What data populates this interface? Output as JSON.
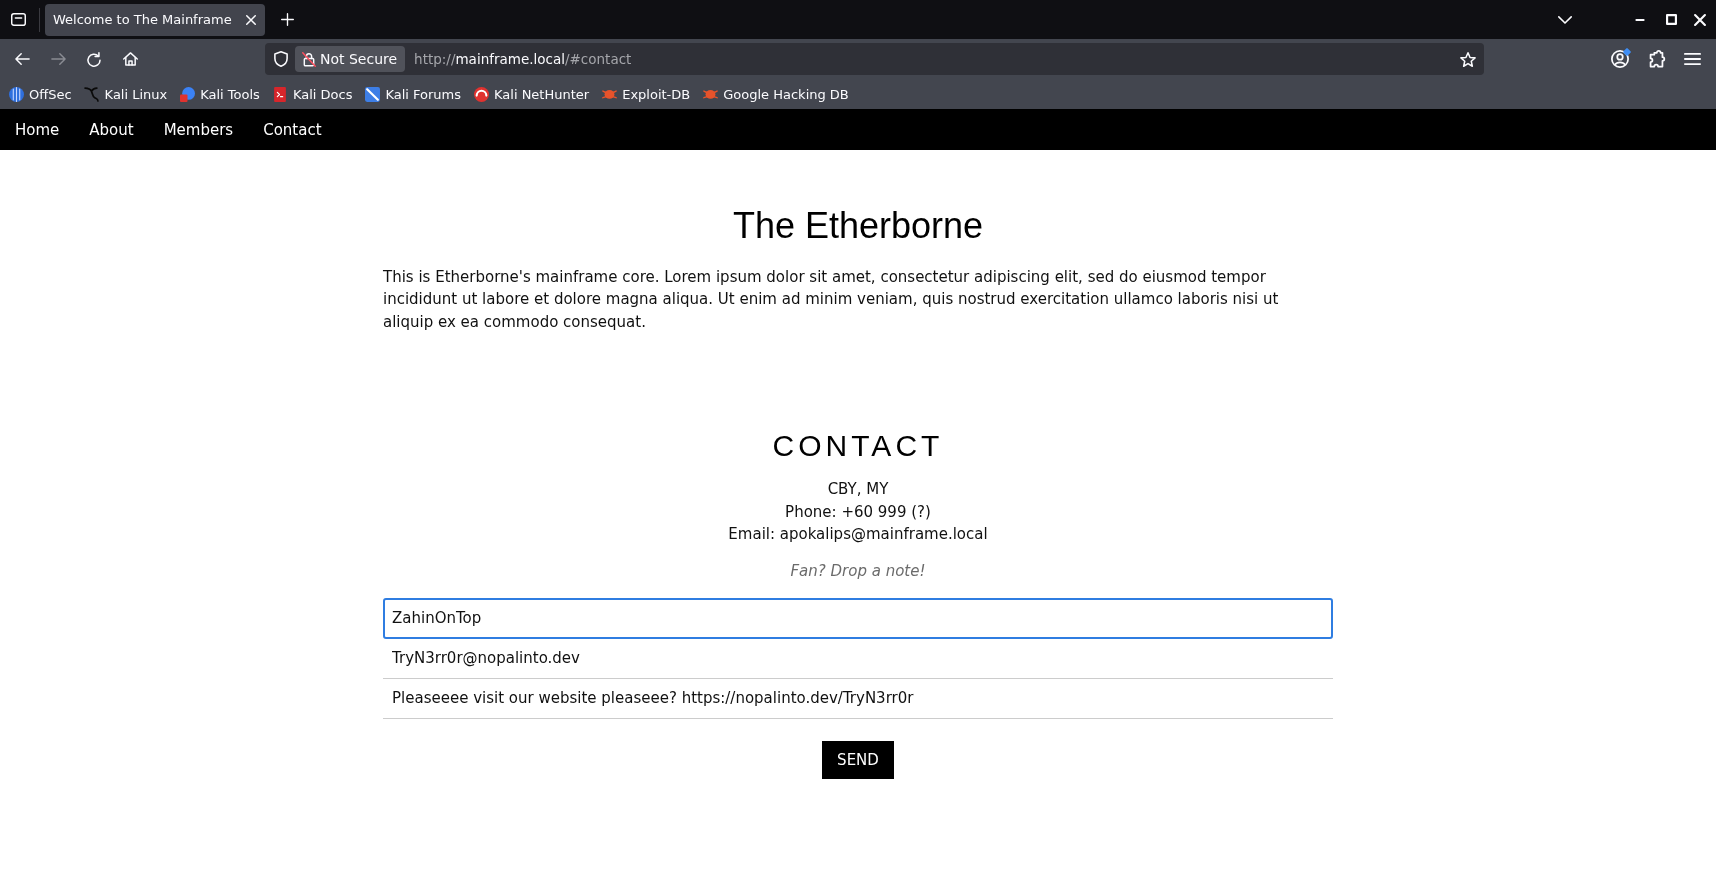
{
  "browser": {
    "tabs": [
      {
        "title": "Welcome to The Mainframe",
        "selected": true
      }
    ],
    "nav_buttons": [
      {
        "kind": "back",
        "disabled": false
      },
      {
        "kind": "forward",
        "disabled": true
      },
      {
        "kind": "reload",
        "disabled": false
      },
      {
        "kind": "home",
        "disabled": false
      }
    ],
    "address_bar": {
      "security_label": "Not Secure",
      "url": {
        "scheme": "http://",
        "host": "mainframe.local",
        "path": "/#contact"
      }
    },
    "toolbar_buttons": [
      {
        "kind": "account",
        "badge": true
      },
      {
        "kind": "extensions",
        "badge": false
      },
      {
        "kind": "menu",
        "badge": false
      }
    ],
    "bookmarks": [
      {
        "label": "OffSec",
        "kind": "offsec"
      },
      {
        "label": "Kali Linux",
        "kind": "dragon"
      },
      {
        "label": "Kali Tools",
        "kind": "tools"
      },
      {
        "label": "Kali Docs",
        "kind": "docs"
      },
      {
        "label": "Kali Forums",
        "kind": "forums"
      },
      {
        "label": "Kali NetHunter",
        "kind": "swirl"
      },
      {
        "label": "Exploit-DB",
        "kind": "bug"
      },
      {
        "label": "Google Hacking DB",
        "kind": "bug"
      }
    ]
  },
  "site_nav": [
    {
      "label": "Home"
    },
    {
      "label": "About"
    },
    {
      "label": "Members"
    },
    {
      "label": "Contact"
    }
  ],
  "page": {
    "title": "The Etherborne",
    "intro": "This is Etherborne's mainframe core. Lorem ipsum dolor sit amet, consectetur adipiscing elit, sed do eiusmod tempor incididunt ut labore et dolore magna aliqua. Ut enim ad minim veniam, quis nostrud exercitation ullamco laboris nisi ut aliquip ex ea commodo consequat.",
    "contact": {
      "heading": "CONTACT",
      "lines": [
        "CBY, MY",
        "Phone: +60 999 (?)",
        "Email: apokalips@mainframe.local"
      ],
      "prompt": "Fan? Drop a note!",
      "fields": [
        {
          "value": "ZahinOnTop",
          "focused": true
        },
        {
          "value": "TryN3rr0r@nopalinto.dev",
          "focused": false
        },
        {
          "value": "Pleaseeee visit our website pleaseee? https://nopalinto.dev/TryN3rr0r",
          "focused": false
        }
      ],
      "submit": "SEND"
    }
  }
}
